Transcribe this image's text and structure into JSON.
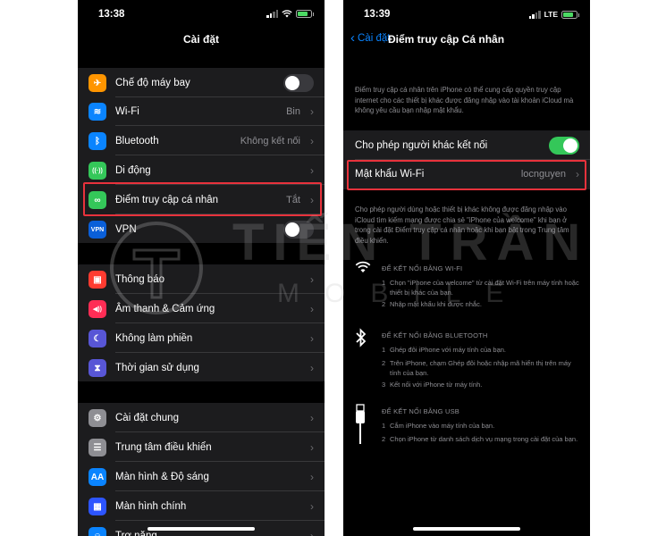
{
  "left": {
    "time": "13:38",
    "title": "Cài đặt",
    "groups": [
      {
        "items": [
          {
            "label": "Chế độ máy bay",
            "value": "",
            "toggle": "off",
            "icon": "airplane-icon",
            "color": "#ff9500",
            "glyph": "✈"
          },
          {
            "label": "Wi-Fi",
            "value": "Bin",
            "icon": "wifi-icon",
            "color": "#0a84ff",
            "glyph": "≋"
          },
          {
            "label": "Bluetooth",
            "value": "Không kết nối",
            "icon": "bluetooth-icon",
            "color": "#0a84ff",
            "glyph": "ᛒ"
          },
          {
            "label": "Di động",
            "value": "",
            "icon": "cellular-icon",
            "color": "#34c759",
            "glyph": "((·))"
          },
          {
            "label": "Điểm truy cập cá nhân",
            "value": "Tắt",
            "icon": "hotspot-icon",
            "color": "#34c759",
            "glyph": "∞"
          },
          {
            "label": "VPN",
            "value": "",
            "toggle": "off",
            "icon": "vpn-icon",
            "color": "#0a5fd8",
            "glyph": "VPN"
          }
        ]
      },
      {
        "items": [
          {
            "label": "Thông báo",
            "value": "",
            "icon": "notifications-icon",
            "color": "#ff3b30",
            "glyph": "▣"
          },
          {
            "label": "Âm thanh & Cảm ứng",
            "value": "",
            "icon": "sounds-icon",
            "color": "#ff2d55",
            "glyph": "◀))"
          },
          {
            "label": "Không làm phiền",
            "value": "",
            "icon": "moon-icon",
            "color": "#5856d6",
            "glyph": "☾"
          },
          {
            "label": "Thời gian sử dụng",
            "value": "",
            "icon": "hourglass-icon",
            "color": "#5856d6",
            "glyph": "⧗"
          }
        ]
      },
      {
        "items": [
          {
            "label": "Cài đặt chung",
            "value": "",
            "icon": "gear-icon",
            "color": "#8e8e93",
            "glyph": "⚙"
          },
          {
            "label": "Trung tâm điều khiển",
            "value": "",
            "icon": "control-center-icon",
            "color": "#8e8e93",
            "glyph": "☰"
          },
          {
            "label": "Màn hình & Độ sáng",
            "value": "",
            "icon": "display-icon",
            "color": "#0a84ff",
            "glyph": "AA"
          },
          {
            "label": "Màn hình chính",
            "value": "",
            "icon": "home-screen-icon",
            "color": "#2d55ff",
            "glyph": "▦"
          },
          {
            "label": "Trợ năng",
            "value": "",
            "icon": "accessibility-icon",
            "color": "#0a84ff",
            "glyph": "☺"
          }
        ]
      }
    ]
  },
  "right": {
    "time": "13:39",
    "carrier": "LTE",
    "back_label": "Cài đặt",
    "title": "Điểm truy cập Cá nhân",
    "intro": "Điểm truy cập cá nhân trên iPhone có thể cung cấp quyền truy cập internet cho các thiết bị khác được đăng nhập vào tài khoản iCloud mà không yêu cầu bạn nhập mật khẩu.",
    "allow_label": "Cho phép người khác kết nối",
    "allow_state": "on",
    "wifi_pw_label": "Mật khẩu Wi-Fi",
    "wifi_pw_value": "locnguyen",
    "note": "Cho phép người dùng hoặc thiết bị khác không được đăng nhập vào iCloud tìm kiếm mạng được chia sẻ \"iPhone của welcome\" khi bạn ở trong cài đặt Điểm truy cập cá nhân hoặc khi bạn bật trong Trung tâm điều khiển.",
    "sections": [
      {
        "title": "ĐỂ KẾT NỐI BẰNG WI-FI",
        "icon": "wifi-icon",
        "steps": [
          {
            "num": "1",
            "text": "Chọn \"iPhone của welcome\" từ cài đặt Wi-Fi trên máy tính hoặc thiết bị khác của bạn."
          },
          {
            "num": "2",
            "text": "Nhập mật khẩu khi được nhắc."
          }
        ]
      },
      {
        "title": "ĐỂ KẾT NỐI BẰNG BLUETOOTH",
        "icon": "bluetooth-icon",
        "steps": [
          {
            "num": "1",
            "text": "Ghép đôi iPhone với máy tính của bạn."
          },
          {
            "num": "2",
            "text": "Trên iPhone, chạm Ghép đôi hoặc nhập mã hiển thị trên máy tính của bạn."
          },
          {
            "num": "3",
            "text": "Kết nối với iPhone từ máy tính."
          }
        ]
      },
      {
        "title": "ĐỂ KẾT NỐI BẰNG USB",
        "icon": "usb-cable-icon",
        "steps": [
          {
            "num": "1",
            "text": "Cắm iPhone vào máy tính của bạn."
          },
          {
            "num": "2",
            "text": "Chọn iPhone từ danh sách dịch vụ mạng trong cài đặt của bạn."
          }
        ]
      }
    ]
  },
  "watermark": {
    "line1": "TIẾN TRẦN",
    "line2": "MOBILE"
  },
  "colors": {
    "accent": "#0a84ff",
    "toggle_on": "#34c759",
    "highlight": "#e8323c"
  }
}
